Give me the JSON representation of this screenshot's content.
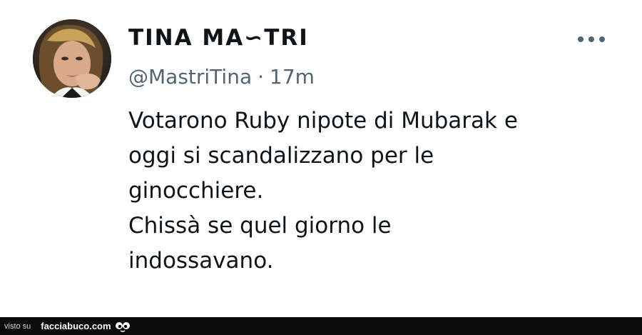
{
  "tweet": {
    "display_name": "TINA MA∽TRI",
    "handle": "@MastriTina",
    "separator": "·",
    "time": "17m",
    "more_icon": "ellipsis-icon",
    "avatar_icon": "avatar",
    "text_lines": [
      "Votarono Ruby nipote di Mubarak e",
      "oggi si scandalizzano per le",
      "ginocchiere.",
      "Chissà se quel giorno le",
      "indossavano."
    ]
  },
  "footer": {
    "seen_on": "visto su",
    "site": "facciabuco.com",
    "logo_icon": "facciabuco-eyes-logo"
  },
  "colors": {
    "text_primary": "#0f1419",
    "text_secondary": "#536471",
    "footer_bg": "#0b0b0b"
  }
}
